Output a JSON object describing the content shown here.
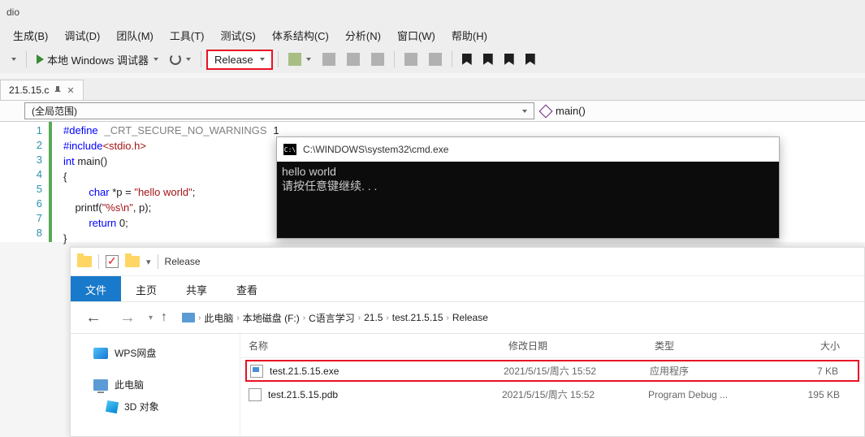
{
  "titlebar": {
    "suffix": "dio"
  },
  "menubar": {
    "items": [
      "生成(B)",
      "调试(D)",
      "团队(M)",
      "工具(T)",
      "测试(S)",
      "体系结构(C)",
      "分析(N)",
      "窗口(W)",
      "帮助(H)"
    ]
  },
  "toolbar": {
    "debugger_label": "本地 Windows 调试器",
    "config": "Release"
  },
  "tab": {
    "filename": "21.5.15.c"
  },
  "scope": {
    "left": "(全局范围)",
    "right": "main()"
  },
  "code": {
    "lines": [
      "1",
      "2",
      "3",
      "4",
      "5",
      "6",
      "7",
      "8"
    ],
    "l1_kw": "#define",
    "l1_mac": "_CRT_SECURE_NO_WARNINGS",
    "l1_num": "1",
    "l2_kw": "#include",
    "l2_inc": "<stdio.h>",
    "l3_kw": "int",
    "l3_fn": " main()",
    "l4": "{",
    "l5_kw": "char",
    "l5_rest": " *p = ",
    "l5_str": "\"hello world\"",
    "l5_semi": ";",
    "l6_a": "    printf(",
    "l6_str": "\"%s\\n\"",
    "l6_b": ", p);",
    "l7_kw": "return",
    "l7_rest": " 0;",
    "l8": "}"
  },
  "cmd": {
    "title": "C:\\WINDOWS\\system32\\cmd.exe",
    "line1": "hello world",
    "line2": "请按任意键继续. . ."
  },
  "explorer": {
    "title": "Release",
    "ribbon": {
      "file": "文件",
      "home": "主页",
      "share": "共享",
      "view": "查看"
    },
    "breadcrumb": [
      "此电脑",
      "本地磁盘 (F:)",
      "C语言学习",
      "21.5",
      "test.21.5.15",
      "Release"
    ],
    "nav": {
      "wps": "WPS网盘",
      "pc": "此电脑",
      "obj3d": "3D 对象"
    },
    "columns": {
      "name": "名称",
      "date": "修改日期",
      "type": "类型",
      "size": "大小"
    },
    "rows": [
      {
        "name": "test.21.5.15.exe",
        "date": "2021/5/15/周六 15:52",
        "type": "应用程序",
        "size": "7 KB"
      },
      {
        "name": "test.21.5.15.pdb",
        "date": "2021/5/15/周六 15:52",
        "type": "Program Debug ...",
        "size": "195 KB"
      }
    ]
  }
}
